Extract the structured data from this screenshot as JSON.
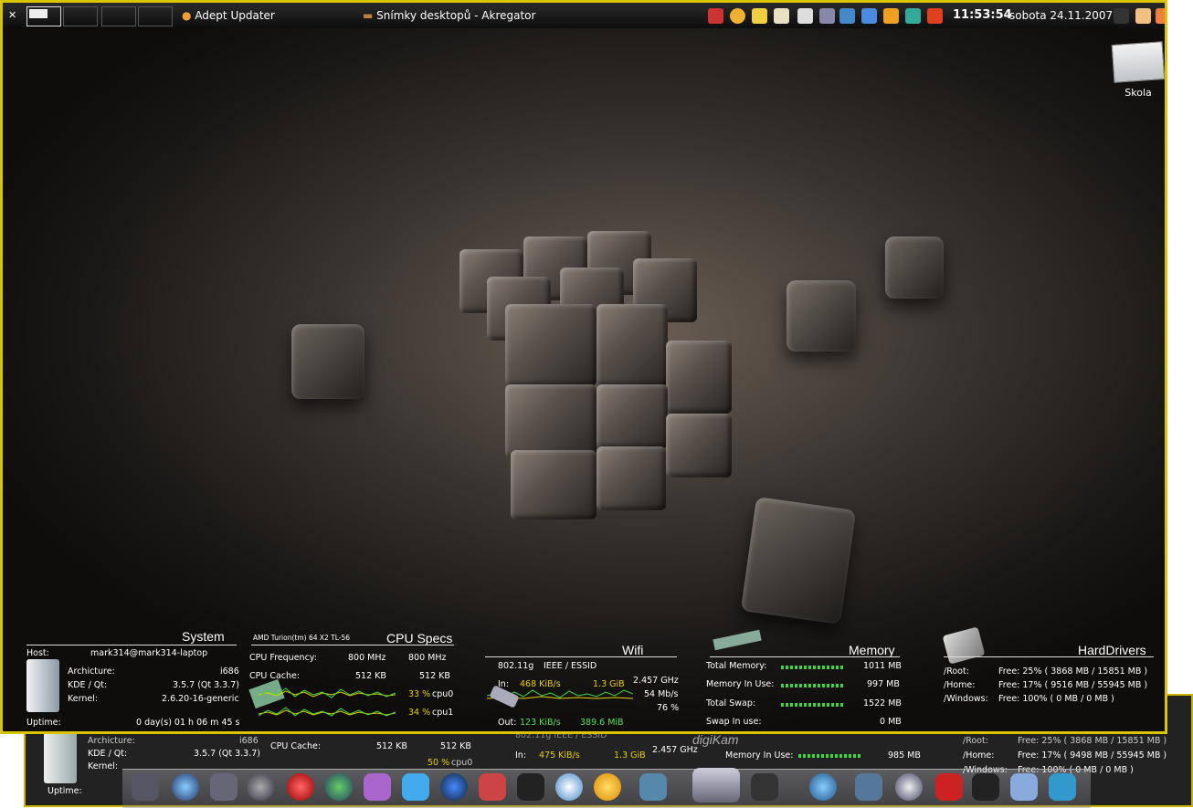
{
  "taskbar": {
    "tasks": [
      "Adept Updater",
      "Snímky desktopů - Akregator"
    ],
    "clock_time": "11:53:54",
    "clock_date": "sobota 24.11.2007"
  },
  "desktop_icons": [
    {
      "label": "Skola"
    }
  ],
  "system": {
    "title": "System",
    "host_label": "Host:",
    "host_value": "mark314@mark314-laptop",
    "arch_label": "Archicture:",
    "arch_value": "i686",
    "kde_label": "KDE / Qt:",
    "kde_value": "3.5.7 (Qt 3.3.7)",
    "kernel_label": "Kernel:",
    "kernel_value": "2.6.20-16-generic",
    "uptime_label": "Uptime:",
    "uptime_value": "0 day(s) 01 h 06 m 45 s"
  },
  "cpu": {
    "title": "CPU Specs",
    "model": "AMD Turion(tm) 64 X2 TL-56",
    "freq_label": "CPU Frequency:",
    "freq0": "800 MHz",
    "freq1": "800 MHz",
    "cache_label": "CPU Cache:",
    "cache0": "512 KB",
    "cache1": "512 KB",
    "cpu0": "33 %",
    "cpu0_label": "cpu0",
    "cpu1": "34 %",
    "cpu1_label": "cpu1"
  },
  "wifi": {
    "title": "Wifi",
    "standard": "802.11g",
    "essid": "IEEE / ESSID",
    "in_label": "In:",
    "in_rate": "468 KiB/s",
    "in_total": "1.3 GiB",
    "freq": "2.457 GHz",
    "speed": "54 Mb/s",
    "quality": "76 %",
    "out_label": "Out:",
    "out_rate": "123 KiB/s",
    "out_total": "389.6 MiB"
  },
  "memory": {
    "title": "Memory",
    "total_label": "Total Memory:",
    "total_value": "1011 MB",
    "inuse_label": "Memory In Use:",
    "inuse_value": "997 MB",
    "swap_label": "Total Swap:",
    "swap_value": "1522 MB",
    "swapuse_label": "Swap In use:",
    "swapuse_value": "0 MB"
  },
  "hdd": {
    "title": "HardDrivers",
    "root_label": "/Root:",
    "root_value": "Free: 25%   ( 3868 MB / 15851 MB )",
    "home_label": "/Home:",
    "home_value": "Free: 17%   ( 9516 MB / 55945 MB )",
    "win_label": "/Windows:",
    "win_value": "Free: 100%   ( 0 MB / 0 MB )"
  },
  "back_window": {
    "arch_label": "Archicture:",
    "arch_value": "i686",
    "kde_label": "KDE / Qt:",
    "kde_value": "3.5.7 (Qt 3.3.7)",
    "kernel_label": "Kernel:",
    "uptime_label": "Uptime:",
    "cache_label": "CPU Cache:",
    "cache0": "512 KB",
    "cache1": "512 KB",
    "cpu0": "50 %",
    "cpu0_label": "cpu0",
    "wifi_std": "802.11g  IEEE / ESSID",
    "in_label": "In:",
    "in_rate": "475 KiB/s",
    "in_total": "1.3 GiB",
    "freq": "2.457 GHz",
    "digikam": "digiKam",
    "mem_label": "Memory In Use:",
    "mem_value": "985 MB",
    "root_label": "/Root:",
    "root_value": "Free: 25%   ( 3868 MB / 15851 MB )",
    "home_label": "/Home:",
    "home_value": "Free: 17%   ( 9498 MB / 55945 MB )",
    "win_label": "/Windows:",
    "win_value": "Free: 100%   ( 0 MB / 0 MB )"
  },
  "colors": {
    "frame": "#d8c400",
    "accent_yellow": "#e6d000",
    "accent_green": "#55e055"
  }
}
